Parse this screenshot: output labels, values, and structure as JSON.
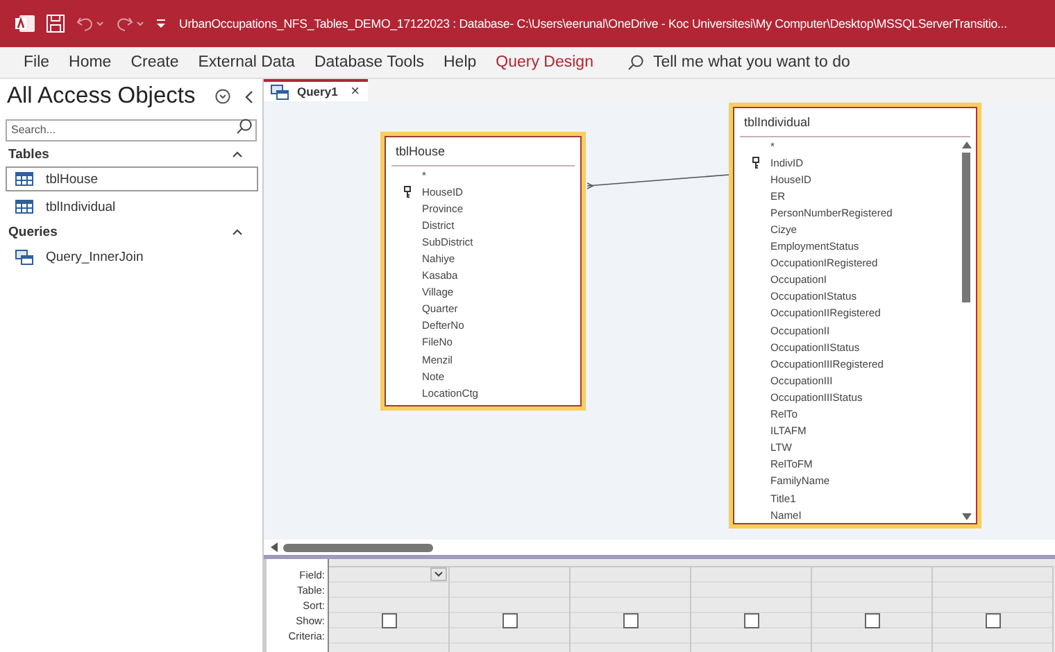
{
  "title_bar": {
    "title": "UrbanOccupations_NFS_Tables_DEMO_17122023 : Database- C:\\Users\\eerunal\\OneDrive - Koc Universitesi\\My Computer\\Desktop\\MSSQLServerTransitio..."
  },
  "menu": [
    {
      "label": "File",
      "selected": false
    },
    {
      "label": "Home",
      "selected": false
    },
    {
      "label": "Create",
      "selected": false
    },
    {
      "label": "External Data",
      "selected": false
    },
    {
      "label": "Database Tools",
      "selected": false
    },
    {
      "label": "Help",
      "selected": false
    },
    {
      "label": "Query Design",
      "selected": true
    }
  ],
  "tell_me": {
    "placeholder": "Tell me what you want to do"
  },
  "navigation": {
    "title": "All Access Objects",
    "search": {
      "placeholder": "Search..."
    },
    "groups": [
      {
        "label": "Tables",
        "expanded": true,
        "items": [
          {
            "label": "tblHouse",
            "kind": "table",
            "selected": true
          },
          {
            "label": "tblIndividual",
            "kind": "table",
            "selected": false
          }
        ]
      },
      {
        "label": "Queries",
        "expanded": true,
        "items": [
          {
            "label": "Query_InnerJoin",
            "kind": "query",
            "selected": false
          }
        ]
      }
    ]
  },
  "document_tabs": [
    {
      "label": "Query1",
      "selected": true,
      "close": "×"
    }
  ],
  "tables": [
    {
      "title": "tblHouse",
      "fields": [
        {
          "name": "*",
          "primary_key": false
        },
        {
          "name": "HouseID",
          "primary_key": true
        },
        {
          "name": "Province",
          "primary_key": false
        },
        {
          "name": "District",
          "primary_key": false
        },
        {
          "name": "SubDistrict",
          "primary_key": false
        },
        {
          "name": "Nahiye",
          "primary_key": false
        },
        {
          "name": "Kasaba",
          "primary_key": false
        },
        {
          "name": "Village",
          "primary_key": false
        },
        {
          "name": "Quarter",
          "primary_key": false
        },
        {
          "name": "DefterNo",
          "primary_key": false
        },
        {
          "name": "FileNo",
          "primary_key": false
        },
        {
          "name": "Menzil",
          "primary_key": false
        },
        {
          "name": "Note",
          "primary_key": false
        },
        {
          "name": "LocationCtg",
          "primary_key": false
        }
      ]
    },
    {
      "title": "tblIndividual",
      "fields": [
        {
          "name": "*",
          "primary_key": false
        },
        {
          "name": "IndivID",
          "primary_key": true
        },
        {
          "name": "HouseID",
          "primary_key": false
        },
        {
          "name": "ER",
          "primary_key": false
        },
        {
          "name": "PersonNumberRegistered",
          "primary_key": false
        },
        {
          "name": "Cizye",
          "primary_key": false
        },
        {
          "name": "EmploymentStatus",
          "primary_key": false
        },
        {
          "name": "OccupationIRegistered",
          "primary_key": false
        },
        {
          "name": "OccupationI",
          "primary_key": false
        },
        {
          "name": "OccupationIStatus",
          "primary_key": false
        },
        {
          "name": "OccupationIIRegistered",
          "primary_key": false
        },
        {
          "name": "OccupationII",
          "primary_key": false
        },
        {
          "name": "OccupationIIStatus",
          "primary_key": false
        },
        {
          "name": "OccupationIIIRegistered",
          "primary_key": false
        },
        {
          "name": "OccupationIII",
          "primary_key": false
        },
        {
          "name": "OccupationIIIStatus",
          "primary_key": false
        },
        {
          "name": "RelTo",
          "primary_key": false
        },
        {
          "name": "ILTAFM",
          "primary_key": false
        },
        {
          "name": "LTW",
          "primary_key": false
        },
        {
          "name": "RelToFM",
          "primary_key": false
        },
        {
          "name": "FamilyName",
          "primary_key": false
        },
        {
          "name": "Title1",
          "primary_key": false
        },
        {
          "name": "NameI",
          "primary_key": false
        }
      ]
    }
  ],
  "query_grid": {
    "row_labels": [
      "Field:",
      "Table:",
      "Sort:",
      "Show:",
      "Criteria:"
    ],
    "columns": [
      {
        "active": true,
        "show": false
      },
      {
        "active": false,
        "show": false
      },
      {
        "active": false,
        "show": false
      },
      {
        "active": false,
        "show": false
      },
      {
        "active": false,
        "show": false
      },
      {
        "active": false,
        "show": false
      }
    ]
  }
}
